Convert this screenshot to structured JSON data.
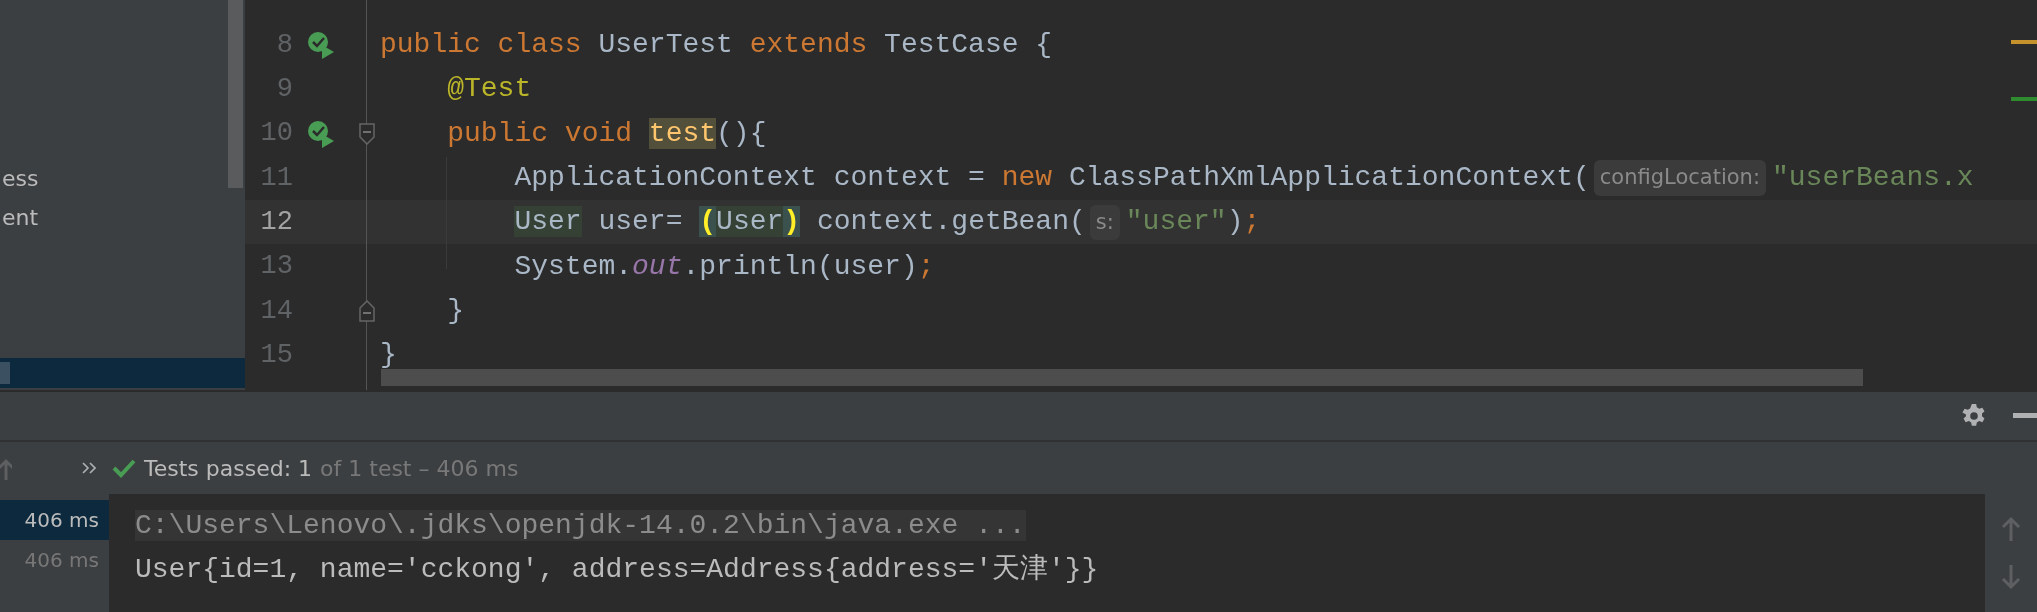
{
  "project_panel": {
    "items": [
      {
        "label": "ess"
      },
      {
        "label": "ent"
      }
    ]
  },
  "editor": {
    "lines": [
      {
        "number": "8",
        "current": false,
        "run_passed": true,
        "tokens": [
          {
            "kind": "keyword",
            "text": "public class "
          },
          {
            "kind": "plain",
            "text": "UserTest "
          },
          {
            "kind": "keyword",
            "text": "extends "
          },
          {
            "kind": "plain",
            "text": "TestCase {"
          }
        ]
      },
      {
        "number": "9",
        "current": false,
        "tokens": [
          {
            "kind": "annotation",
            "text": "    @Test"
          }
        ]
      },
      {
        "number": "10",
        "current": false,
        "run_passed": true,
        "fold_start": true,
        "tokens": [
          {
            "kind": "keyword",
            "text": "    public void "
          },
          {
            "kind": "method",
            "text": "test"
          },
          {
            "kind": "plain",
            "text": "(){"
          }
        ]
      },
      {
        "number": "11",
        "current": false,
        "tokens": [
          {
            "kind": "plain",
            "text": "        ApplicationContext context = "
          },
          {
            "kind": "keyword",
            "text": "new "
          },
          {
            "kind": "plain",
            "text": "ClassPathXmlApplicationContext("
          },
          {
            "kind": "hint",
            "text": "configLocation:"
          },
          {
            "kind": "string",
            "text": "\"userBeans.x"
          }
        ]
      },
      {
        "number": "12",
        "current": true,
        "tokens": [
          {
            "kind": "type_ref",
            "text": "        User"
          },
          {
            "kind": "plain",
            "text": " user= "
          },
          {
            "kind": "brace",
            "text": "("
          },
          {
            "kind": "type_ref",
            "text": "User"
          },
          {
            "kind": "brace",
            "text": ")"
          },
          {
            "kind": "plain",
            "text": " context.getBean("
          },
          {
            "kind": "hint",
            "text": "s:"
          },
          {
            "kind": "string",
            "text": "\"user\""
          },
          {
            "kind": "plain",
            "text": ")"
          },
          {
            "kind": "semicolon",
            "text": ";"
          }
        ]
      },
      {
        "number": "13",
        "current": false,
        "tokens": [
          {
            "kind": "plain",
            "text": "        System."
          },
          {
            "kind": "static",
            "text": "out"
          },
          {
            "kind": "plain",
            "text": ".println(user)"
          },
          {
            "kind": "semicolon",
            "text": ";"
          }
        ]
      },
      {
        "number": "14",
        "current": false,
        "fold_end": true,
        "tokens": [
          {
            "kind": "plain",
            "text": "    }"
          }
        ]
      },
      {
        "number": "15",
        "current": false,
        "tokens": [
          {
            "kind": "plain",
            "text": "}"
          }
        ]
      }
    ]
  },
  "run_panel": {
    "status": {
      "passed": "Tests passed: 1",
      "detail": "of 1 test – 406 ms"
    },
    "tests": [
      {
        "duration": "406 ms",
        "selected": true
      },
      {
        "duration": "406 ms",
        "selected": false
      }
    ],
    "console": [
      {
        "kind": "command",
        "text": "C:\\Users\\Lenovo\\.jdks\\openjdk-14.0.2\\bin\\java.exe ..."
      },
      {
        "kind": "output",
        "text": "User{id=1, name='cckong', address=Address{address='天津'}}"
      }
    ]
  }
}
